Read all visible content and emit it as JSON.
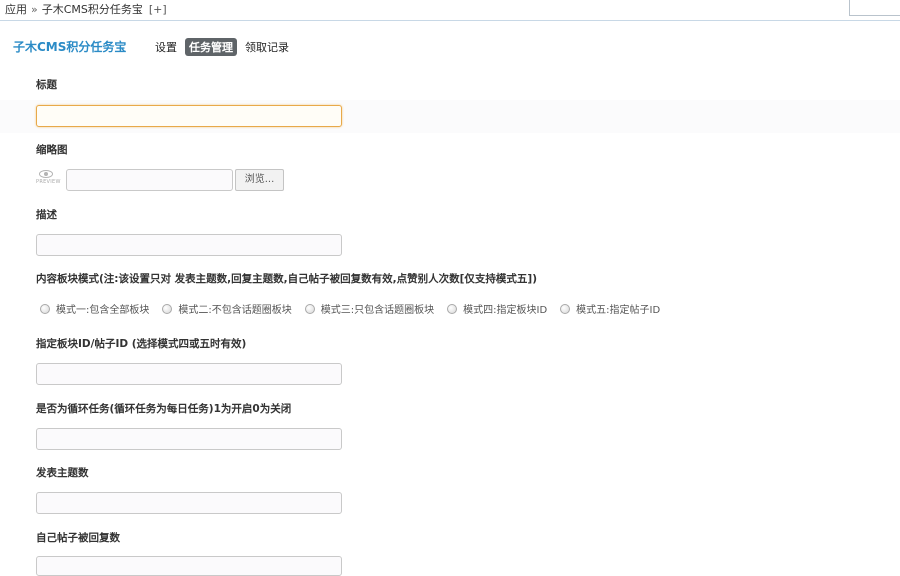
{
  "breadcrumb": {
    "root": "应用",
    "separator": "»",
    "current": "子木CMS积分任务宝",
    "add_label": "[+]"
  },
  "plugin": {
    "title": "子木CMS积分任务宝",
    "nav": [
      {
        "label": "设置",
        "active": false
      },
      {
        "label": "任务管理",
        "active": true
      },
      {
        "label": "领取记录",
        "active": false
      }
    ]
  },
  "form": {
    "title_label": "标题",
    "title_value": "",
    "thumbnail_label": "缩略图",
    "preview_text": "PREVIEW",
    "browse_label": "浏览...",
    "description_label": "描述",
    "description_value": "",
    "mode_label": "内容板块模式(注:该设置只对 发表主题数,回复主题数,自己帖子被回复数有效,点赞别人次数[仅支持模式五])",
    "mode_options": [
      "模式一:包含全部板块",
      "模式二:不包含话题圈板块",
      "模式三:只包含话题圈板块",
      "模式四:指定板块ID",
      "模式五:指定帖子ID"
    ],
    "target_id_label": "指定板块ID/帖子ID (选择模式四或五时有效)",
    "target_id_value": "",
    "loop_label": "是否为循环任务(循环任务为每日任务)1为开启0为关闭",
    "loop_value": "",
    "post_count_label": "发表主题数",
    "post_count_value": "",
    "reply_count_label": "自己帖子被回复数",
    "reply_count_value": ""
  },
  "colors": {
    "accent": "#2b8bc6",
    "nav_active_bg": "#5f6468",
    "focus_border": "#e8a94a"
  }
}
